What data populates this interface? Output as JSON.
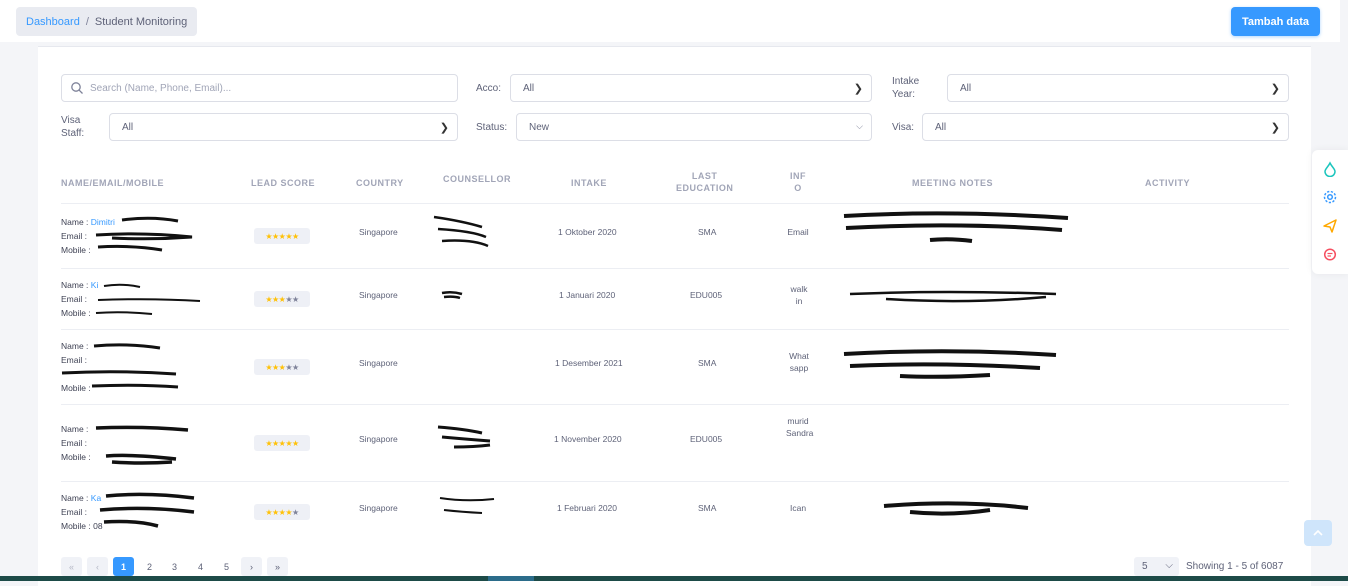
{
  "breadcrumb": {
    "home": "Dashboard",
    "separator": "/",
    "current": "Student Monitoring"
  },
  "header": {
    "add_button": "Tambah data"
  },
  "filters": {
    "search_placeholder": "Search (Name, Phone, Email)...",
    "acco_label": "Acco:",
    "acco_value": "All",
    "intake_year_label_1": "Intake",
    "intake_year_label_2": "Year:",
    "intake_year_value": "All",
    "visa_staff_label_1": "Visa",
    "visa_staff_label_2": "Staff:",
    "visa_staff_value": "All",
    "status_label": "Status:",
    "status_value": "New",
    "visa_label": "Visa:",
    "visa_value": "All"
  },
  "table": {
    "headers": {
      "name": "NAME/EMAIL/MOBILE",
      "lead_score": "LEAD SCORE",
      "country": "COUNTRY",
      "counsellor": "COUNSELLOR",
      "intake": "INTAKE",
      "last_education_1": "LAST",
      "last_education_2": "EDUCATION",
      "info_1": "INF",
      "info_2": "O",
      "meeting_notes": "MEETING NOTES",
      "activity": "ACTIVITY"
    },
    "labels": {
      "name": "Name",
      "email": "Email",
      "mobile": "Mobile"
    },
    "rows": [
      {
        "name": "Dimitri",
        "email": "",
        "mobile": "",
        "stars": 5,
        "country": "Singapore",
        "intake": "1 Oktober 2020",
        "education": "SMA",
        "info": "Email"
      },
      {
        "name": "Ki",
        "email": "",
        "mobile": "",
        "stars": 3,
        "country": "Singapore",
        "intake": "1 Januari 2020",
        "education": "EDU005",
        "info": "walk in"
      },
      {
        "name": "",
        "email": "",
        "mobile": "",
        "stars": 3,
        "country": "Singapore",
        "intake": "1 Desember 2021",
        "education": "SMA",
        "info": "What sapp"
      },
      {
        "name": "",
        "email": "",
        "mobile": "",
        "stars": 5,
        "country": "Singapore",
        "intake": "1 November 2020",
        "education": "EDU005",
        "info": "murid Sandra"
      },
      {
        "name": "Ka",
        "email": "",
        "mobile": "08",
        "stars": 4,
        "country": "Singapore",
        "intake": "1 Februari 2020",
        "education": "SMA",
        "info": "Ican"
      }
    ]
  },
  "pagination": {
    "pages": [
      "1",
      "2",
      "3",
      "4",
      "5"
    ],
    "first": "«",
    "prev": "‹",
    "next": "›",
    "last": "»",
    "page_size": "5",
    "showing": "Showing 1 - 5 of 6087"
  },
  "colors": {
    "primary": "#3699ff",
    "star": "#ffc107"
  },
  "icons": [
    "search-icon",
    "chevron-down-icon",
    "droplet-icon",
    "gear-icon",
    "paper-plane-icon",
    "chat-icon",
    "arrow-up-icon"
  ]
}
